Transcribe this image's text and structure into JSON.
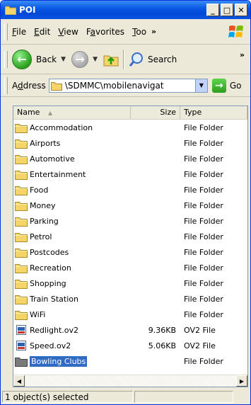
{
  "window": {
    "title": "POI"
  },
  "menu": {
    "items": [
      {
        "pre": "",
        "u": "F",
        "post": "ile"
      },
      {
        "pre": "",
        "u": "E",
        "post": "dit"
      },
      {
        "pre": "",
        "u": "V",
        "post": "iew"
      },
      {
        "pre": "F",
        "u": "a",
        "post": "vorites"
      },
      {
        "pre": "",
        "u": "T",
        "post": "oo"
      }
    ],
    "overflow": "»"
  },
  "toolbar": {
    "back_label": "Back",
    "search_label": "Search",
    "overflow": "»"
  },
  "address": {
    "label_pre": "A",
    "label_u": "d",
    "label_post": "dress",
    "value": "\\SDMMC\\mobilenavigat",
    "go_label": "Go"
  },
  "columns": {
    "name": "Name",
    "size": "Size",
    "type": "Type"
  },
  "rows": [
    {
      "name": "Accommodation",
      "size": "",
      "type": "File Folder",
      "icon": "folder-icon"
    },
    {
      "name": "Airports",
      "size": "",
      "type": "File Folder",
      "icon": "folder-icon"
    },
    {
      "name": "Automotive",
      "size": "",
      "type": "File Folder",
      "icon": "folder-icon"
    },
    {
      "name": "Entertainment",
      "size": "",
      "type": "File Folder",
      "icon": "folder-icon"
    },
    {
      "name": "Food",
      "size": "",
      "type": "File Folder",
      "icon": "folder-icon"
    },
    {
      "name": "Money",
      "size": "",
      "type": "File Folder",
      "icon": "folder-icon"
    },
    {
      "name": "Parking",
      "size": "",
      "type": "File Folder",
      "icon": "folder-icon"
    },
    {
      "name": "Petrol",
      "size": "",
      "type": "File Folder",
      "icon": "folder-icon"
    },
    {
      "name": "Postcodes",
      "size": "",
      "type": "File Folder",
      "icon": "folder-icon"
    },
    {
      "name": "Recreation",
      "size": "",
      "type": "File Folder",
      "icon": "folder-icon"
    },
    {
      "name": "Shopping",
      "size": "",
      "type": "File Folder",
      "icon": "folder-icon"
    },
    {
      "name": "Train Station",
      "size": "",
      "type": "File Folder",
      "icon": "folder-icon"
    },
    {
      "name": "WiFi",
      "size": "",
      "type": "File Folder",
      "icon": "folder-icon"
    },
    {
      "name": "Redlight.ov2",
      "size": "9.36KB",
      "type": "OV2 File",
      "icon": "ov2-file-icon"
    },
    {
      "name": "Speed.ov2",
      "size": "5.06KB",
      "type": "OV2 File",
      "icon": "ov2-file-icon"
    },
    {
      "name": "Bowling Clubs",
      "size": "",
      "type": "File Folder",
      "icon": "folder-icon",
      "selected": true
    }
  ],
  "status": {
    "text": "1 object(s) selected"
  },
  "colors": {
    "titlebar": "#0a5ae4",
    "selection": "#316ac5",
    "folder": "#f5d46a"
  }
}
